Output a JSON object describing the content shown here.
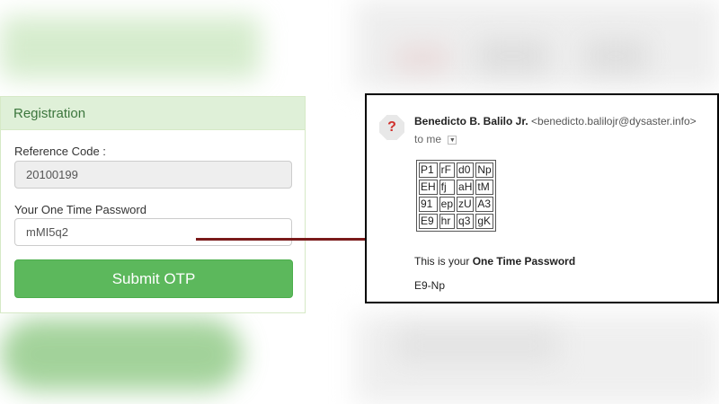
{
  "registration": {
    "header": "Registration",
    "reference_label": "Reference Code :",
    "reference_value": "20100199",
    "otp_label": "Your One Time Password",
    "otp_value": "mMI5q2",
    "submit_label": "Submit OTP"
  },
  "email": {
    "avatar_icon": "unknown-sender-icon",
    "sender_name": "Benedicto B. Balilo Jr.",
    "sender_email": "<benedicto.balilojr@dysaster.info>",
    "to_text": "to me",
    "grid": [
      [
        "P1",
        "rF",
        "d0",
        "Np"
      ],
      [
        "EH",
        "fj",
        "aH",
        "tM"
      ],
      [
        "91",
        "ep",
        "zU",
        "A3"
      ],
      [
        "E9",
        "hr",
        "q3",
        "gK"
      ]
    ],
    "message_prefix": "This is your ",
    "message_bold": "One Time Password",
    "otp_hint": "E9-Np"
  },
  "colors": {
    "panel_header_bg": "#dff0d8",
    "button_green": "#5cb85c",
    "connector": "#7a1a1a"
  }
}
